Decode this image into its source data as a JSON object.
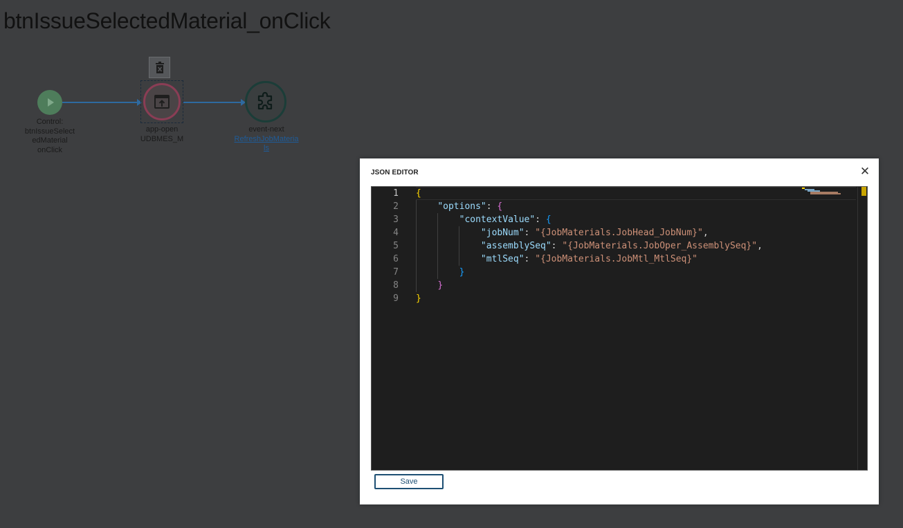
{
  "page": {
    "title": "btnIssueSelectedMaterial_onClick"
  },
  "workflow": {
    "nodes": [
      {
        "id": "start",
        "label_lines": [
          "Control:",
          "btnIssueSelect",
          "edMaterial",
          "onClick"
        ]
      },
      {
        "id": "app-open",
        "label_lines": [
          "app-open",
          "UDBMES_M"
        ]
      },
      {
        "id": "event-next",
        "label_lines": [
          "event-next"
        ],
        "link_lines": [
          "RefreshJobMateria",
          "ls"
        ]
      }
    ],
    "icons": {
      "start": "play-icon",
      "app_open": "open-app-icon",
      "event_next": "puzzle-piece-icon",
      "delete": "trash-icon"
    }
  },
  "modal": {
    "title": "JSON EDITOR",
    "close_label": "✕",
    "save_label": "Save",
    "editor": {
      "line_numbers": [
        "1",
        "2",
        "3",
        "4",
        "5",
        "6",
        "7",
        "8",
        "9"
      ],
      "active_line": 1,
      "lines": [
        {
          "indent": "",
          "tokens": [
            {
              "t": "{",
              "c": "b1"
            }
          ]
        },
        {
          "indent": "    ",
          "tokens": [
            {
              "t": "\"options\"",
              "c": "key"
            },
            {
              "t": ": ",
              "c": ""
            },
            {
              "t": "{",
              "c": "b2"
            }
          ]
        },
        {
          "indent": "        ",
          "tokens": [
            {
              "t": "\"contextValue\"",
              "c": "key"
            },
            {
              "t": ": ",
              "c": ""
            },
            {
              "t": "{",
              "c": "b3"
            }
          ]
        },
        {
          "indent": "            ",
          "tokens": [
            {
              "t": "\"jobNum\"",
              "c": "key"
            },
            {
              "t": ": ",
              "c": ""
            },
            {
              "t": "\"{JobMaterials.JobHead_JobNum}\"",
              "c": "str"
            },
            {
              "t": ",",
              "c": ""
            }
          ]
        },
        {
          "indent": "            ",
          "tokens": [
            {
              "t": "\"assemblySeq\"",
              "c": "key"
            },
            {
              "t": ": ",
              "c": ""
            },
            {
              "t": "\"{JobMaterials.JobOper_AssemblySeq}\"",
              "c": "str"
            },
            {
              "t": ",",
              "c": ""
            }
          ]
        },
        {
          "indent": "            ",
          "tokens": [
            {
              "t": "\"mtlSeq\"",
              "c": "key"
            },
            {
              "t": ": ",
              "c": ""
            },
            {
              "t": "\"{JobMaterials.JobMtl_MtlSeq}\"",
              "c": "str"
            }
          ]
        },
        {
          "indent": "        ",
          "tokens": [
            {
              "t": "}",
              "c": "b3"
            }
          ]
        },
        {
          "indent": "    ",
          "tokens": [
            {
              "t": "}",
              "c": "b2"
            }
          ]
        },
        {
          "indent": "",
          "tokens": [
            {
              "t": "}",
              "c": "b1"
            }
          ]
        }
      ]
    }
  },
  "colors": {
    "background": "#3d3e40",
    "connector": "#2e6aa0",
    "start_node": "#4e7d5b",
    "app_node_ring": "#8a3d55",
    "event_node_ring": "#1b3d38",
    "editor_bg": "#1e1e1e",
    "save_border": "#1d4f73"
  }
}
